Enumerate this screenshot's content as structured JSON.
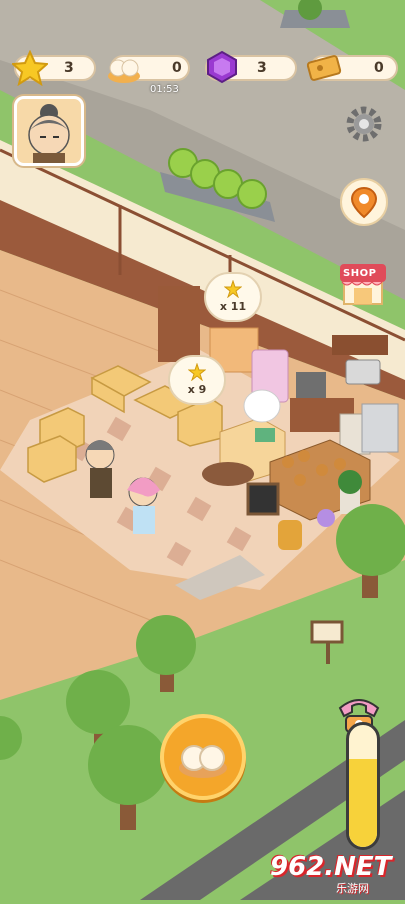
{
  "hud": {
    "stars": "3",
    "buns": "0",
    "gems": "3",
    "tickets": "0",
    "timer": "01:53"
  },
  "bubbles": [
    {
      "label": "x 11"
    },
    {
      "label": "x 9"
    }
  ],
  "shop": {
    "label": "SHOP"
  },
  "meter": {
    "level_fraction": 0.72
  },
  "watermark": {
    "main": "962.NET",
    "sub": "乐游网"
  },
  "icons": [
    "star-icon",
    "bun-icon",
    "gem-icon",
    "ticket-icon",
    "settings-gear-icon",
    "map-pin-icon",
    "shop-icon",
    "phone-icon",
    "bun-serve-icon"
  ],
  "colors": {
    "grass": "#8fc46a",
    "floor": "#e8b98a",
    "accent": "#f4a62a",
    "meter": "#f7d23a"
  }
}
